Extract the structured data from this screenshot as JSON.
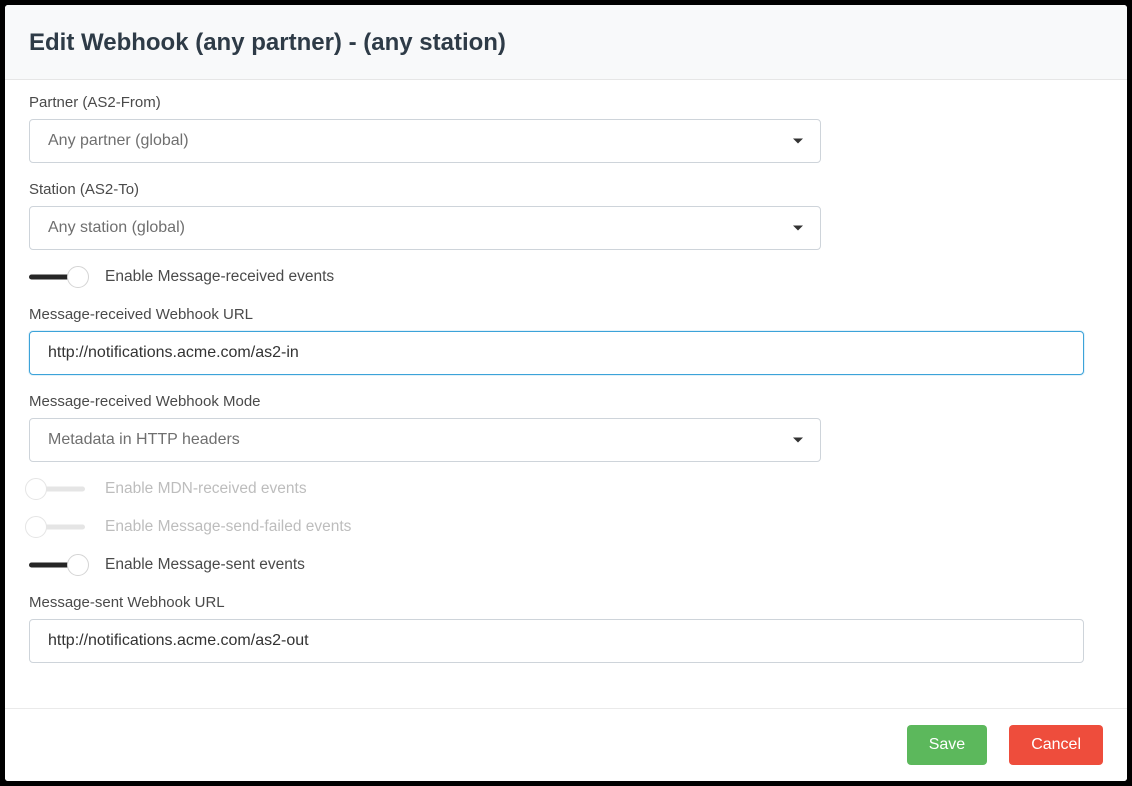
{
  "header": {
    "title": "Edit Webhook (any partner) - (any station)"
  },
  "fields": {
    "partner": {
      "label": "Partner (AS2-From)",
      "value": "Any partner (global)"
    },
    "station": {
      "label": "Station (AS2-To)",
      "value": "Any station (global)"
    },
    "enable_msg_received": "Enable Message-received events",
    "msg_received_url": {
      "label": "Message-received Webhook URL",
      "value": "http://notifications.acme.com/as2-in"
    },
    "msg_received_mode": {
      "label": "Message-received Webhook Mode",
      "value": "Metadata in HTTP headers"
    },
    "enable_mdn_received": "Enable MDN-received events",
    "enable_msg_send_failed": "Enable Message-send-failed events",
    "enable_msg_sent": "Enable Message-sent events",
    "msg_sent_url": {
      "label": "Message-sent Webhook URL",
      "value": "http://notifications.acme.com/as2-out"
    }
  },
  "footer": {
    "save": "Save",
    "cancel": "Cancel"
  },
  "colors": {
    "save_btn": "#5cb85c",
    "cancel_btn": "#ee4d3c",
    "focus_border": "#3ca3d9"
  }
}
